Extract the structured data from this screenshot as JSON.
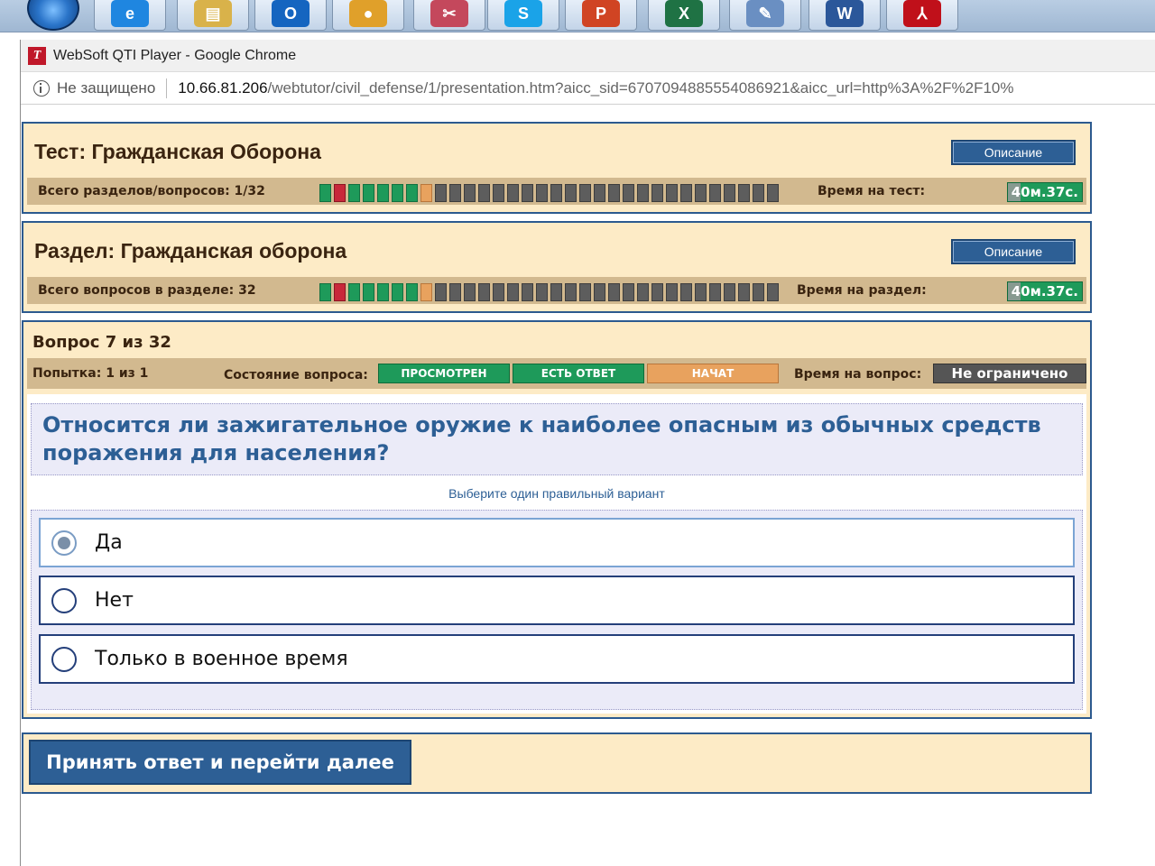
{
  "taskbar": {
    "apps": [
      {
        "name": "ie-icon",
        "glyph": "e",
        "color": "#1f86e0"
      },
      {
        "name": "file-explorer-icon",
        "glyph": "▤",
        "color": "#d9b24a"
      },
      {
        "name": "outlook-icon",
        "glyph": "O",
        "color": "#1565c0"
      },
      {
        "name": "chrome-icon",
        "glyph": "●",
        "color": "#e0a02a"
      },
      {
        "name": "snipping-tool-icon",
        "glyph": "✂",
        "color": "#c4485c"
      },
      {
        "name": "skype-icon",
        "glyph": "S",
        "color": "#1aa3e8"
      },
      {
        "name": "powerpoint-icon",
        "glyph": "P",
        "color": "#d04423"
      },
      {
        "name": "excel-icon",
        "glyph": "X",
        "color": "#1f7244"
      },
      {
        "name": "paint-icon",
        "glyph": "✎",
        "color": "#6a8fc2"
      },
      {
        "name": "word-icon",
        "glyph": "W",
        "color": "#2b579a"
      },
      {
        "name": "acrobat-icon",
        "glyph": "⅄",
        "color": "#c0101a"
      }
    ]
  },
  "window": {
    "title": "WebSoft QTI Player - Google Chrome",
    "not_secure": "Не защищено",
    "url_host": "10.66.81.206",
    "url_path": "/webtutor/civil_defense/1/presentation.htm?aicc_sid=6707094885554086921&aicc_url=http%3A%2F%2F10%"
  },
  "test": {
    "title": "Тест: Гражданская Оборона",
    "description_button": "Описание",
    "progress_label": "Всего разделов/вопросов: 1/32",
    "time_label": "Время на тест:",
    "time_value": "40м.37с."
  },
  "section": {
    "title": "Раздел: Гражданская оборона",
    "description_button": "Описание",
    "progress_label": "Всего вопросов в разделе: 32",
    "time_label": "Время на раздел:",
    "time_value": "40м.37с."
  },
  "progress": {
    "total": 32,
    "states": [
      "g",
      "r",
      "g",
      "g",
      "g",
      "g",
      "g",
      "o",
      "n",
      "n",
      "n",
      "n",
      "n",
      "n",
      "n",
      "n",
      "n",
      "n",
      "n",
      "n",
      "n",
      "n",
      "n",
      "n",
      "n",
      "n",
      "n",
      "n",
      "n",
      "n",
      "n",
      "n"
    ]
  },
  "question": {
    "header": "Вопрос 7 из 32",
    "attempt": "Попытка: 1 из 1",
    "state_label": "Состояние вопроса:",
    "state_viewed": "ПРОСМОТРЕН",
    "state_answered": "ЕСТЬ ОТВЕТ",
    "state_started": "НАЧАТ",
    "time_label": "Время на вопрос:",
    "time_value": "Не ограничено",
    "text": "Относится ли зажигательное оружие к наиболее опасным из обычных средств поражения для населения?",
    "hint": "Выберите один правильный вариант",
    "options": [
      {
        "label": "Да",
        "selected": true
      },
      {
        "label": "Нет",
        "selected": false
      },
      {
        "label": "Только в военное время",
        "selected": false
      }
    ]
  },
  "submit_button": "Принять ответ и перейти далее"
}
